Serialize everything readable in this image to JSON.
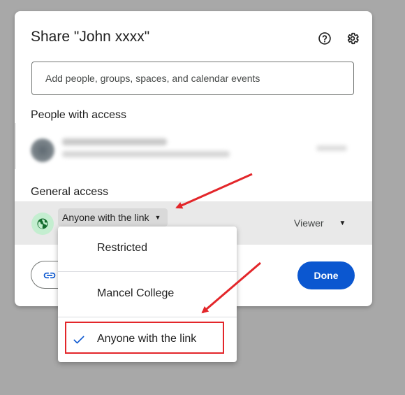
{
  "dialog": {
    "title": "Share \"John xxxx\"",
    "help_icon": "help-circle-icon",
    "settings_icon": "gear-icon"
  },
  "search": {
    "placeholder": "Add people, groups, spaces, and calendar events"
  },
  "people_section": {
    "title": "People with access"
  },
  "general_access": {
    "title": "General access",
    "globe_icon": "globe-icon",
    "current_value": "Anyone with the link",
    "role": "Viewer"
  },
  "actions": {
    "copy_link_icon": "link-icon",
    "done_label": "Done"
  },
  "access_menu": {
    "items": [
      {
        "label": "Restricted",
        "selected": false
      },
      {
        "label": "Mancel College",
        "selected": false
      },
      {
        "label": "Anyone with the link",
        "selected": true
      }
    ]
  },
  "colors": {
    "primary": "#0b57d0",
    "annotation_red": "#e3262a",
    "globe_bg": "#c4eed0",
    "globe_fg": "#146c2e"
  }
}
